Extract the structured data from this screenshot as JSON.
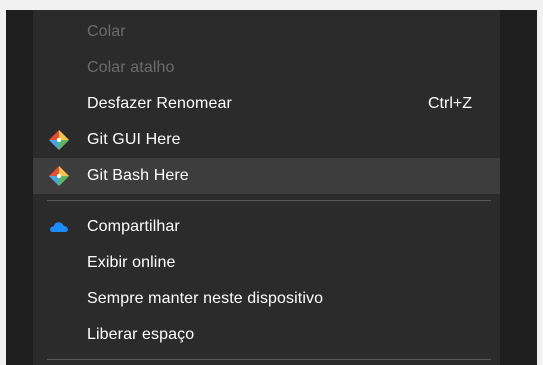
{
  "context_menu": {
    "items": [
      {
        "label": "Colar",
        "disabled": true
      },
      {
        "label": "Colar atalho",
        "disabled": true
      },
      {
        "label": "Desfazer Renomear",
        "shortcut": "Ctrl+Z"
      },
      {
        "label": "Git GUI Here",
        "icon": "git-icon"
      },
      {
        "label": "Git Bash Here",
        "icon": "git-icon",
        "highlighted": true
      }
    ],
    "items2": [
      {
        "label": "Compartilhar",
        "icon": "onedrive-cloud-icon"
      },
      {
        "label": "Exibir online"
      },
      {
        "label": "Sempre manter neste dispositivo"
      },
      {
        "label": "Liberar espaço"
      }
    ]
  },
  "colors": {
    "menu_background": "#2b2b2b",
    "hover_background": "#3d3d3d",
    "disabled_text": "#6b6b6b",
    "onedrive_blue": "#1a8cff"
  }
}
